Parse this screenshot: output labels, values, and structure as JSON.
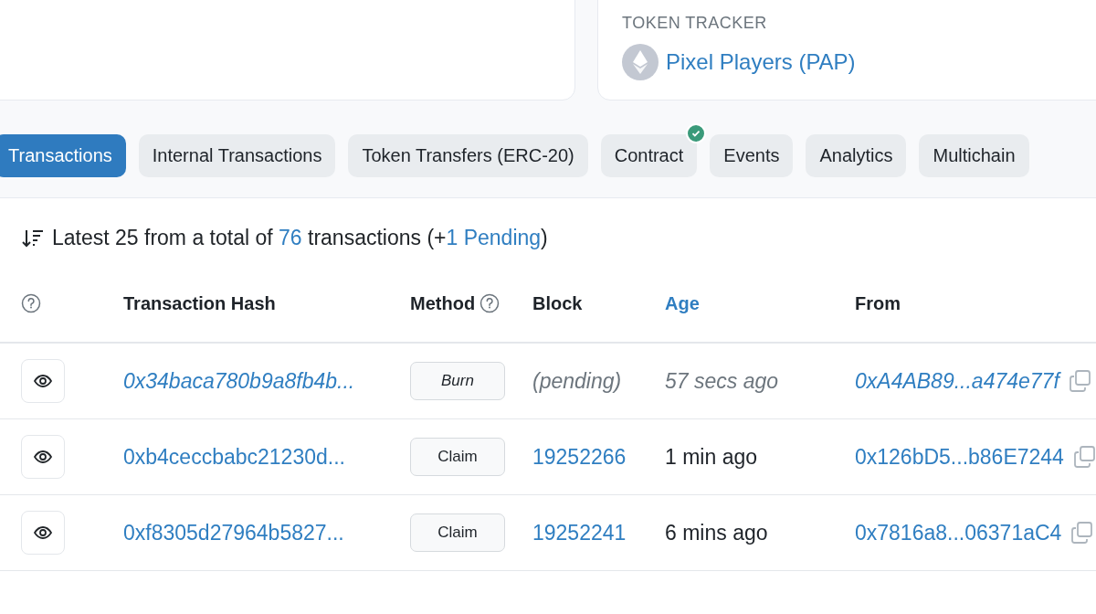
{
  "token_tracker": {
    "label": "TOKEN TRACKER",
    "name": "Pixel Players (PAP)"
  },
  "tabs": [
    {
      "label": "Transactions",
      "selected": true,
      "verified": false
    },
    {
      "label": "Internal Transactions",
      "selected": false,
      "verified": false
    },
    {
      "label": "Token Transfers (ERC-20)",
      "selected": false,
      "verified": false
    },
    {
      "label": "Contract",
      "selected": false,
      "verified": true
    },
    {
      "label": "Events",
      "selected": false,
      "verified": false
    },
    {
      "label": "Analytics",
      "selected": false,
      "verified": false
    },
    {
      "label": "Multichain",
      "selected": false,
      "verified": false
    }
  ],
  "summary": {
    "prefix": "Latest 25 from a total of",
    "total": "76",
    "middle": "transactions (+",
    "pending": "1 Pending",
    "suffix": ")"
  },
  "table": {
    "columns": [
      {
        "label": "Transaction Hash",
        "sorted": false,
        "help": false
      },
      {
        "label": "Method",
        "sorted": false,
        "help": true
      },
      {
        "label": "Block",
        "sorted": false,
        "help": false
      },
      {
        "label": "Age",
        "sorted": true,
        "help": false
      },
      {
        "label": "From",
        "sorted": false,
        "help": false
      }
    ],
    "rows": [
      {
        "pending": true,
        "hash": "0x34baca780b9a8fb4b...",
        "method": "Burn",
        "block": "(pending)",
        "age": "57 secs ago",
        "from": "0xA4AB89...a474e77f"
      },
      {
        "pending": false,
        "hash": "0xb4ceccbabc21230d...",
        "method": "Claim",
        "block": "19252266",
        "age": "1 min ago",
        "from": "0x126bD5...b86E7244"
      },
      {
        "pending": false,
        "hash": "0xf8305d27964b5827...",
        "method": "Claim",
        "block": "19252241",
        "age": "6 mins ago",
        "from": "0x7816a8...06371aC4"
      }
    ]
  }
}
